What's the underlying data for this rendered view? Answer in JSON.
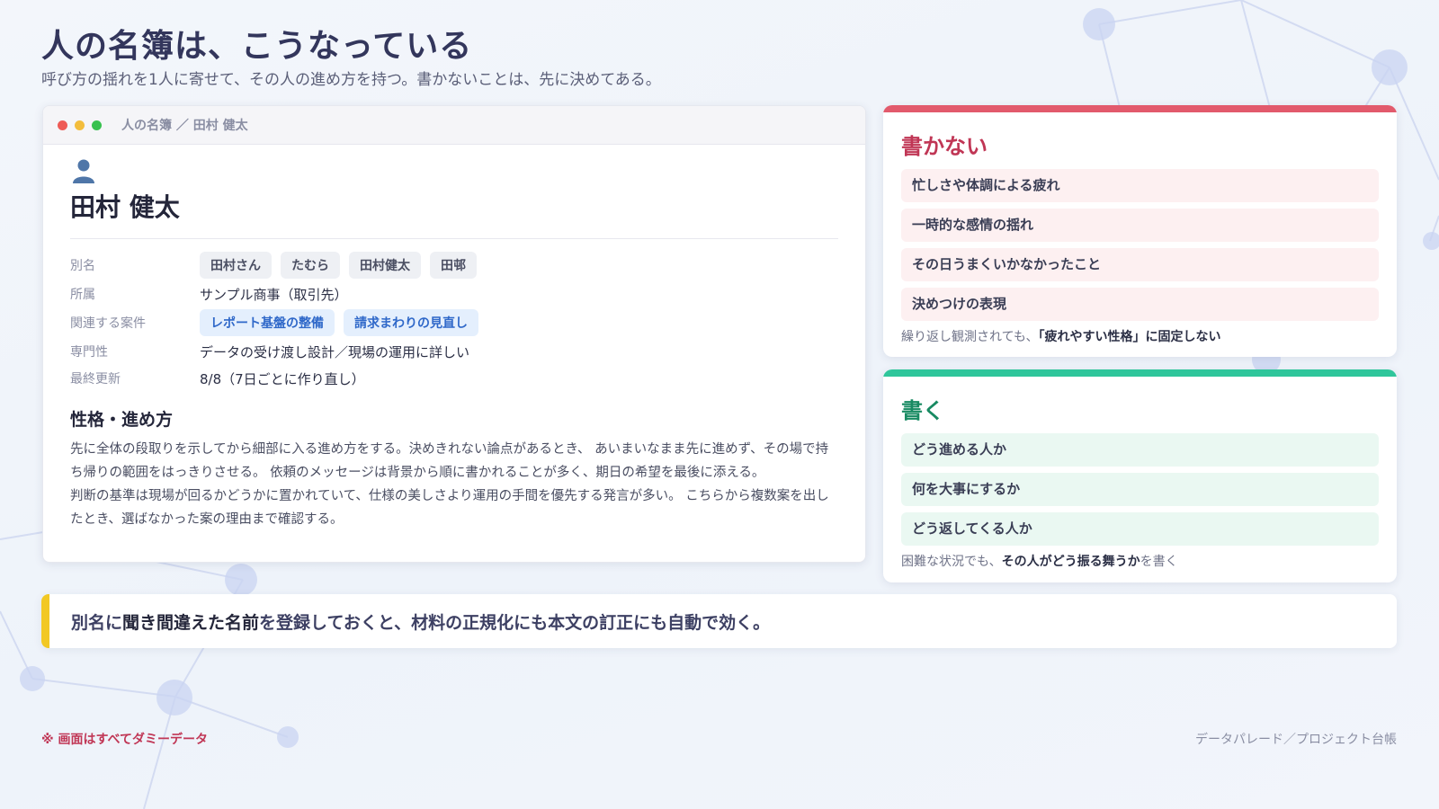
{
  "page": {
    "title": "人の名簿は、こうなっている",
    "subtitle": "呼び方の揺れを1人に寄せて、その人の進め方を持つ。書かないことは、先に決めてある。"
  },
  "window": {
    "path": "人の名簿 ／ 田村 健太",
    "person_icon": "person-icon",
    "name": "田村 健太",
    "fields": {
      "alias_label": "別名",
      "aliases": [
        "田村さん",
        "たむら",
        "田村健太",
        "田邨"
      ],
      "org_label": "所属",
      "org_value": "サンプル商事（取引先）",
      "projects_label": "関連する案件",
      "projects": [
        "レポート基盤の整備",
        "請求まわりの見直し"
      ],
      "expertise_label": "専門性",
      "expertise_value": "データの受け渡し設計／現場の運用に詳しい",
      "updated_label": "最終更新",
      "updated_value": "8/8（7日ごとに作り直し）"
    },
    "section_title": "性格・進め方",
    "paragraphs": [
      "先に全体の段取りを示してから細部に入る進め方をする。決めきれない論点があるとき、 あいまいなまま先に進めず、その場で持ち帰りの範囲をはっきりさせる。 依頼のメッセージは背景から順に書かれることが多く、期日の希望を最後に添える。",
      "判断の基準は現場が回るかどうかに置かれていて、仕様の美しさより運用の手間を優先する発言が多い。 こちらから複数案を出したとき、選ばなかった案の理由まで確認する。"
    ]
  },
  "dont_write": {
    "title": "書かない",
    "items": [
      "忙しさや体調による疲れ",
      "一時的な感情の揺れ",
      "その日うまくいかなかったこと",
      "決めつけの表現"
    ],
    "note_prefix": "繰り返し観測されても、",
    "note_emphasis": "「疲れやすい性格」に固定しない",
    "accent_color": "#e25a6c"
  },
  "do_write": {
    "title": "書く",
    "items": [
      "どう進める人か",
      "何を大事にするか",
      "どう返してくる人か"
    ],
    "note_prefix": "困難な状況でも、",
    "note_emphasis": "その人がどう振る舞うか",
    "note_suffix": "を書く",
    "accent_color": "#2fc69b"
  },
  "callout": {
    "part1": "別名に",
    "emphasis": "聞き間違えた名前",
    "part2": "を登録しておくと、材料の正規化にも本文の訂正にも自動で効く。",
    "accent_color": "#f2c824"
  },
  "footer": {
    "left": "※ 画面はすべてダミーデータ",
    "right": "データパレード／プロジェクト台帳"
  }
}
